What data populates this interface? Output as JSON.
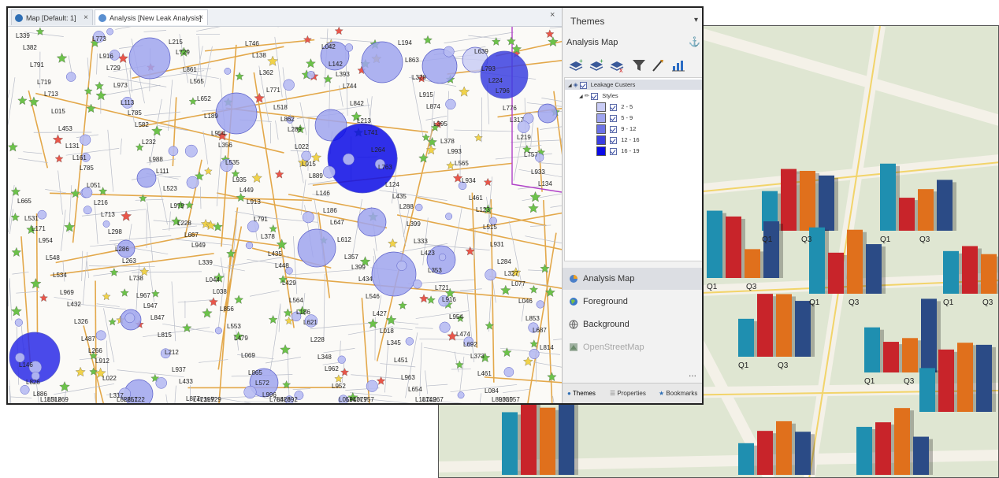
{
  "tabs": [
    {
      "label": "Map [Default: 1]",
      "close": "×"
    },
    {
      "label": "Analysis [New Leak Analysis]",
      "close": "×"
    }
  ],
  "tab_bar_close": "×",
  "panel": {
    "title": "Themes",
    "pin": "▾",
    "subtitle": "Analysis Map",
    "toolbar_icons": [
      "add-layer-icon",
      "add-layer-stack-icon",
      "remove-layer-icon",
      "filter-icon",
      "style-brush-icon",
      "chart-icon"
    ],
    "tree": {
      "root_label": "Leakage Custers",
      "styles_label": "Styles",
      "classes": [
        {
          "label": "2 - 5",
          "color": "#c9ccf5"
        },
        {
          "label": "5 - 9",
          "color": "#9fa5ef"
        },
        {
          "label": "9 - 12",
          "color": "#6c73e6"
        },
        {
          "label": "12 - 16",
          "color": "#3b3fe0"
        },
        {
          "label": "16 - 19",
          "color": "#0a0ae6"
        }
      ]
    },
    "splitter": "......",
    "nav": [
      {
        "label": "Analysis Map",
        "selected": true,
        "icon": "analysis-map-icon"
      },
      {
        "label": "Foreground",
        "selected": false,
        "icon": "foreground-globe-icon"
      },
      {
        "label": "Background",
        "selected": false,
        "icon": "background-globe-icon"
      },
      {
        "label": "OpenStreetMap",
        "selected": false,
        "icon": "openstreetmap-icon",
        "dimmed": true
      }
    ],
    "more": "...",
    "bottom_tabs": [
      "Themes",
      "Properties",
      "Bookmarks"
    ]
  },
  "map": {
    "bubble_labels": [
      "L339",
      "L773",
      "L215",
      "L746",
      "L042",
      "L194",
      "L639",
      "L382",
      "L916",
      "L729",
      "L138",
      "L142",
      "L863",
      "L793",
      "L791",
      "L729",
      "L861",
      "L362",
      "L393",
      "L328",
      "L224",
      "L719",
      "L973",
      "L565",
      "L771",
      "L744",
      "L915",
      "L796",
      "L713",
      "L113",
      "L652",
      "L518",
      "L842",
      "L874",
      "L776",
      "L015",
      "L785",
      "L189",
      "L862",
      "L213",
      "L395",
      "L317",
      "L453",
      "L582",
      "L954",
      "L289",
      "L741",
      "L378",
      "L219",
      "L131",
      "L232",
      "L356",
      "L022",
      "L264",
      "L993",
      "L757",
      "L161",
      "L988",
      "L535",
      "L915",
      "L763",
      "L565",
      "L933",
      "L785",
      "L111",
      "L935",
      "L889",
      "L124",
      "L934",
      "L134",
      "L051",
      "L523",
      "L449",
      "L146",
      "L435",
      "L461",
      "L665",
      "L216",
      "L979",
      "L913",
      "L186",
      "L288",
      "L123",
      "L531",
      "L713",
      "L228",
      "L791",
      "L647",
      "L399",
      "L515",
      "L171",
      "L298",
      "L667",
      "L378",
      "L612",
      "L333",
      "L931",
      "L954",
      "L286",
      "L949",
      "L435",
      "L357",
      "L423",
      "L284",
      "L548",
      "L263",
      "L339",
      "L448",
      "L399",
      "L353",
      "L327",
      "L534",
      "L738",
      "L044",
      "L429",
      "L434",
      "L721",
      "L077",
      "L969",
      "L967",
      "L038",
      "L564",
      "L546",
      "L916",
      "L046",
      "L432",
      "L947",
      "L856",
      "L186",
      "L427",
      "L954",
      "L853",
      "L326",
      "L847",
      "L553",
      "L621",
      "L018",
      "L474",
      "L687",
      "L487",
      "L815",
      "L479",
      "L228",
      "L345",
      "L692",
      "L814",
      "L266",
      "L212",
      "L069",
      "L348",
      "L451",
      "L373",
      "L146",
      "L912",
      "L937",
      "L865",
      "L962",
      "L963",
      "L461",
      "L826",
      "L022",
      "L433",
      "L572",
      "L952",
      "L654",
      "L084",
      "L886",
      "L317",
      "L877",
      "L996",
      "L058",
      "L181",
      "L893",
      "L185",
      "L828",
      "L473",
      "L788",
      "L943",
      "L749",
      "L035",
      "L312",
      "L257",
      "L197",
      "L428",
      "L079",
      "L267",
      "L057",
      "L869",
      "L122",
      "L929",
      "L692",
      "L757"
    ]
  },
  "background_map": {
    "chart_labels": [
      "Q1",
      "Q3",
      "Q1",
      "Q3",
      "Q1",
      "Q3",
      "Q1",
      "Q3",
      "Q1",
      "Q3",
      "Q1",
      "Q3",
      "Q1",
      "Q3",
      "Q1",
      "Q3",
      "Q1",
      "Q3",
      "Q1",
      "Q3"
    ],
    "bar_colors": [
      "#1f8fb0",
      "#c8242a",
      "#e0701c",
      "#2b4b86"
    ]
  }
}
